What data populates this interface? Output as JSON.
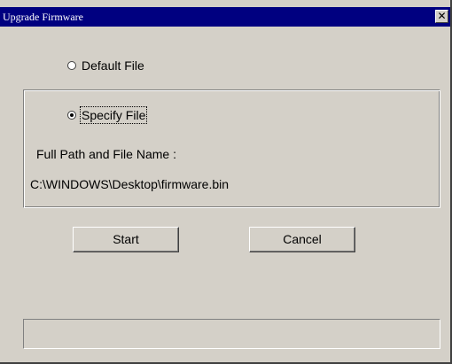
{
  "window": {
    "title": "Upgrade Firmware",
    "close_glyph": "✕"
  },
  "options": {
    "default_file_label": "Default File",
    "default_file_selected": false,
    "specify_file_label": "Specify File",
    "specify_file_selected": true
  },
  "path": {
    "label": "Full Path and File Name :",
    "value": "C:\\WINDOWS\\Desktop\\firmware.bin"
  },
  "buttons": {
    "start_label": "Start",
    "cancel_label": "Cancel"
  },
  "status": {
    "text": ""
  },
  "colors": {
    "title_bar": "#000080",
    "window_face": "#d4d0c8"
  }
}
